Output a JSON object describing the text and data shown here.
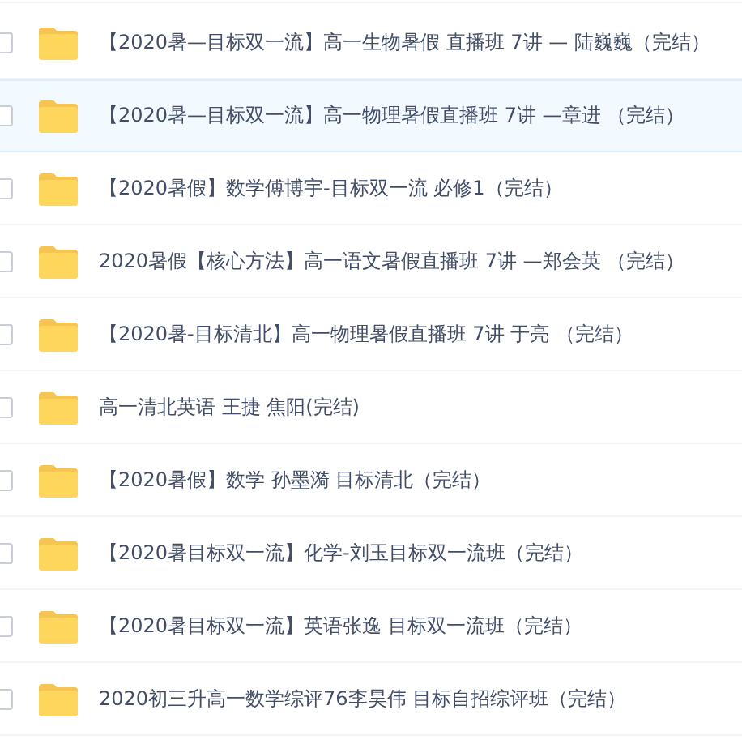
{
  "files": [
    {
      "name": "【2020暑—目标双一流】高一生物暑假 直播班 7讲 — 陆巍巍（完结）",
      "selected": false,
      "checked": false
    },
    {
      "name": "【2020暑—目标双一流】高一物理暑假直播班 7讲 —章进 （完结）",
      "selected": true,
      "checked": false
    },
    {
      "name": "【2020暑假】数学傅博宇-目标双一流 必修1（完结）",
      "selected": false,
      "checked": false
    },
    {
      "name": "2020暑假【核心方法】高一语文暑假直播班 7讲 —郑会英 （完结）",
      "selected": false,
      "checked": false
    },
    {
      "name": "【2020暑-目标清北】高一物理暑假直播班 7讲 于亮 （完结）",
      "selected": false,
      "checked": false
    },
    {
      "name": "高一清北英语 王捷 焦阳(完结)",
      "selected": false,
      "checked": false
    },
    {
      "name": "【2020暑假】数学 孙墨漪 目标清北（完结）",
      "selected": false,
      "checked": false
    },
    {
      "name": "【2020暑目标双一流】化学-刘玉目标双一流班（完结）",
      "selected": false,
      "checked": false
    },
    {
      "name": "【2020暑目标双一流】英语张逸 目标双一流班（完结）",
      "selected": false,
      "checked": false
    },
    {
      "name": "2020初三升高一数学综评76李昊伟 目标自招综评班（完结）",
      "selected": false,
      "checked": false
    }
  ]
}
